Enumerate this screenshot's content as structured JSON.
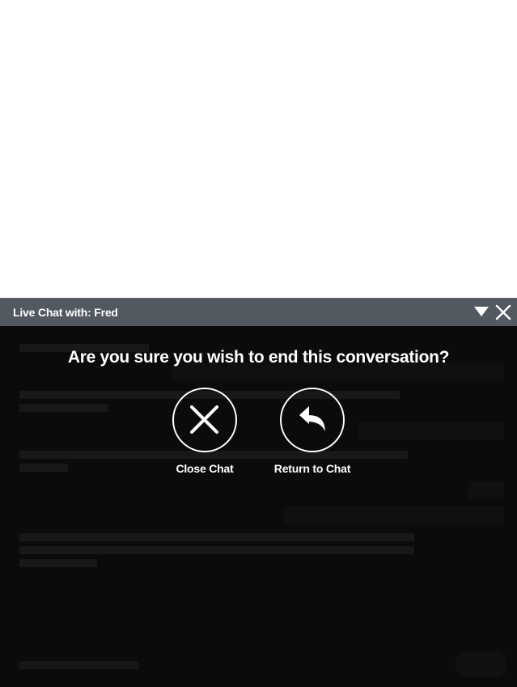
{
  "chat": {
    "title": "Live Chat with: Fred"
  },
  "confirm": {
    "question": "Are you sure you wish to end this conversation?",
    "close_label": "Close Chat",
    "return_label": "Return to Chat"
  },
  "colors": {
    "header_bg": "#535961",
    "body_bg": "#0b0b0b",
    "overlay_text": "#ffffff"
  },
  "icons": {
    "minimize": "triangle-down-icon",
    "close": "close-icon",
    "close_chat": "x-icon",
    "return_chat": "reply-arrow-icon"
  }
}
